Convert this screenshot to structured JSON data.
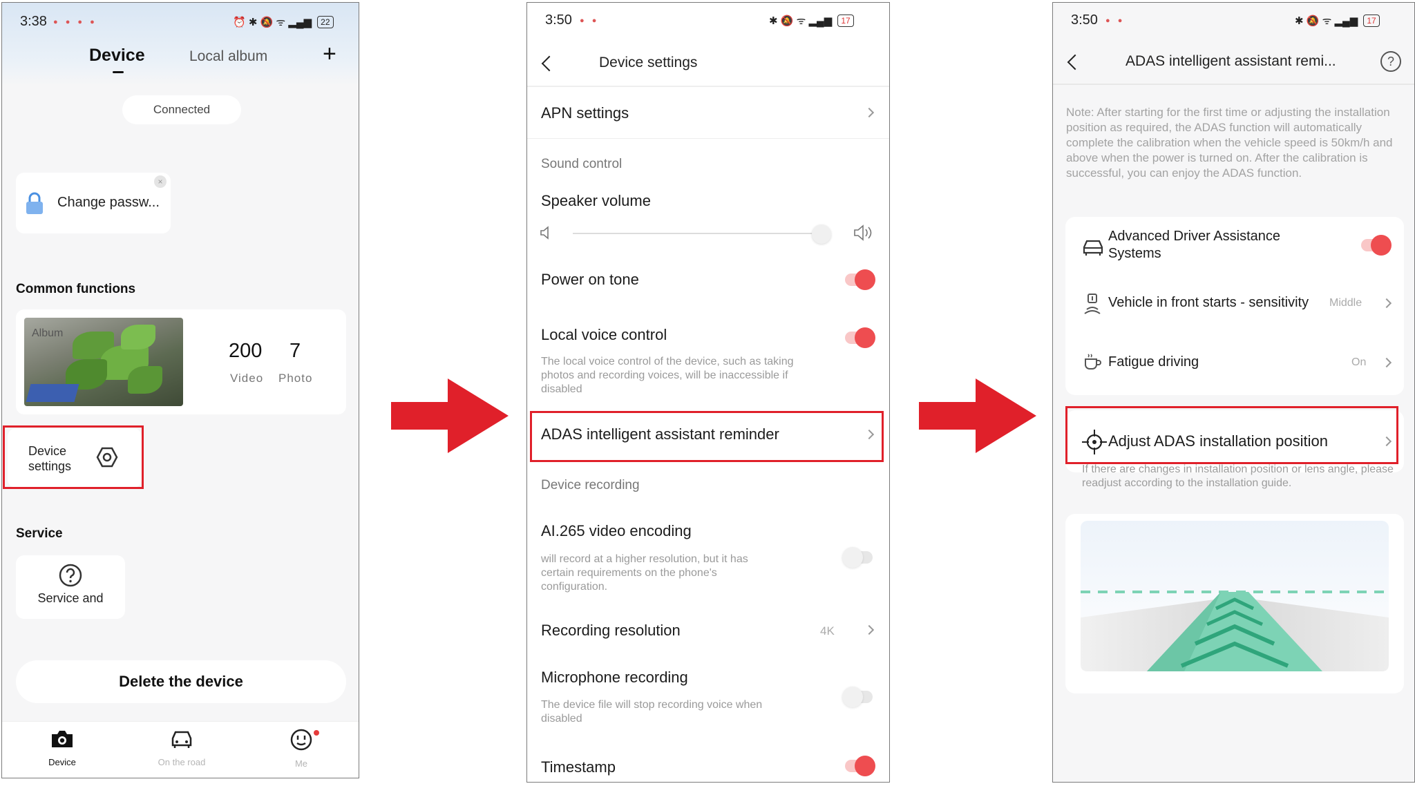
{
  "colors": {
    "accent": "#ee4d50",
    "highlight_box": "#e0202a",
    "arrow": "#e0202a",
    "road_green": "#7dd3b5"
  },
  "screen1": {
    "status": {
      "time": "3:38",
      "battery": "22"
    },
    "tabs": {
      "device": "Device",
      "album": "Local album"
    },
    "add_icon": "plus-icon",
    "connection_status": "Connected",
    "password_card": {
      "label": "Change passw...",
      "icon": "lock-icon",
      "close": "×"
    },
    "common_functions_title": "Common functions",
    "album": {
      "tag": "Album",
      "video_count": "200",
      "video_label": "Video",
      "photo_count": "7",
      "photo_label": "Photo"
    },
    "device_settings": {
      "line1": "Device",
      "line2": "settings",
      "icon": "settings-hex-icon"
    },
    "service_title": "Service",
    "service_card": {
      "label": "Service and",
      "icon": "help-circle-icon"
    },
    "delete_label": "Delete the device",
    "nav": [
      {
        "label": "Device",
        "icon": "camera-icon",
        "active": true
      },
      {
        "label": "On the road",
        "icon": "car-icon",
        "active": false
      },
      {
        "label": "Me",
        "icon": "smiley-icon",
        "active": false
      }
    ]
  },
  "screen2": {
    "status": {
      "time": "3:50",
      "battery": "17"
    },
    "title": "Device settings",
    "apn": "APN settings",
    "sound_group": "Sound control",
    "speaker_volume": "Speaker volume",
    "speaker_volume_level": 0.95,
    "power_on_tone": {
      "label": "Power on tone",
      "on": true
    },
    "local_voice": {
      "label": "Local voice control",
      "on": true,
      "desc": "The local voice control of the device, such as taking photos and recording voices, will be inaccessible if disabled"
    },
    "adas_reminder": "ADAS intelligent assistant reminder",
    "recording_group": "Device recording",
    "ai265": {
      "label": "AI.265 video encoding",
      "on": false,
      "desc": "will record at a higher resolution, but it has certain requirements on the phone's configuration."
    },
    "recording_resolution": {
      "label": "Recording resolution",
      "value": "4K"
    },
    "microphone": {
      "label": "Microphone recording",
      "on": false,
      "desc": "The device file will stop recording voice when disabled"
    },
    "timestamp": {
      "label": "Timestamp",
      "on": true
    }
  },
  "screen3": {
    "status": {
      "time": "3:50",
      "battery": "17"
    },
    "title": "ADAS intelligent assistant remi...",
    "note": "Note: After starting for the first time or adjusting the installation position as required, the ADAS function will automatically complete the calibration when the vehicle speed is 50km/h and above when the power is turned on. After the calibration is successful, you can enjoy the ADAS function.",
    "adas": {
      "line1": "Advanced Driver Assistance",
      "line2": "Systems",
      "on": true,
      "icon": "car-front-icon"
    },
    "vehicle_front": {
      "label": "Vehicle in front starts - sensitivity",
      "value": "Middle",
      "icon": "vehicle-sensor-icon"
    },
    "fatigue": {
      "label": "Fatigue driving",
      "value": "On",
      "icon": "coffee-cup-icon"
    },
    "adjust": {
      "label": "Adjust ADAS installation position",
      "icon": "crosshair-icon",
      "desc": "If there are changes in installation position or lens angle, please readjust according to the installation guide."
    }
  }
}
